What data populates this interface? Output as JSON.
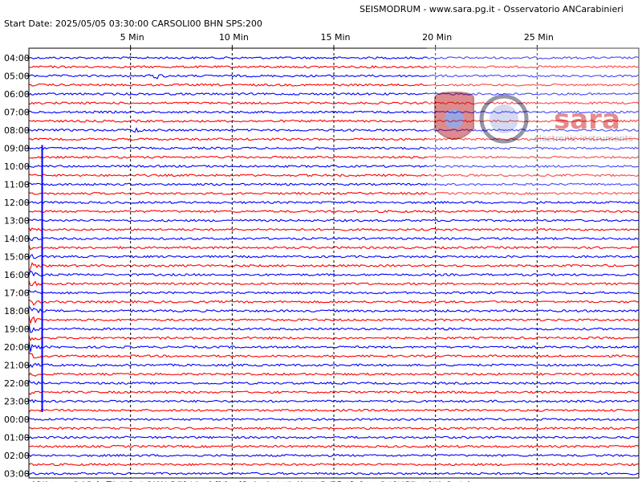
{
  "header": {
    "title": "SEISMODRUM - www.sara.pg.it - Osservatorio ANCarabinieri",
    "meta": "Start Date: 2025/05/05 03:30:00 CARSOLI00 BHN  SPS:200"
  },
  "colors": {
    "trace_a": "#ff0000",
    "trace_b": "#0000ff",
    "grid": "#000000",
    "background": "#ffffff"
  },
  "watermark": {
    "logo_text": "sara",
    "logo_subtext": "electronic instruments",
    "badge_icons": [
      "carabinieri-crest-icon",
      "seal-icon"
    ]
  },
  "chart_data": {
    "type": "helicorder",
    "minute_ticks": [
      {
        "minute": 5,
        "label": "5 Min"
      },
      {
        "minute": 10,
        "label": "10 Min"
      },
      {
        "minute": 15,
        "label": "15 Min"
      },
      {
        "minute": 20,
        "label": "20 Min"
      },
      {
        "minute": 25,
        "label": "25 Min"
      }
    ],
    "x_range_minutes": [
      0,
      30
    ],
    "hour_labels": [
      "04:00",
      "05:00",
      "06:00",
      "07:00",
      "08:00",
      "09:00",
      "10:00",
      "11:00",
      "12:00",
      "13:00",
      "14:00",
      "15:00",
      "16:00",
      "17:00",
      "18:00",
      "19:00",
      "20:00",
      "21:00",
      "22:00",
      "23:00",
      "00:00",
      "01:00",
      "02:00",
      "03:00"
    ],
    "traces_per_hour": 2,
    "grid": true,
    "events": [
      {
        "name": "large event",
        "start_hour_index": 5,
        "end_hour_index": 19.6,
        "peak_hour_index": 14.5,
        "minute": 0.1
      },
      {
        "name": "local disturbance",
        "hour_index": 1,
        "minute": 6.3
      },
      {
        "name": "local disturbance",
        "hour_index": 4,
        "minute": 5.3
      }
    ],
    "data_gap": {
      "hour_index": 23.5,
      "from_minute": 22,
      "to_minute": 30
    }
  }
}
